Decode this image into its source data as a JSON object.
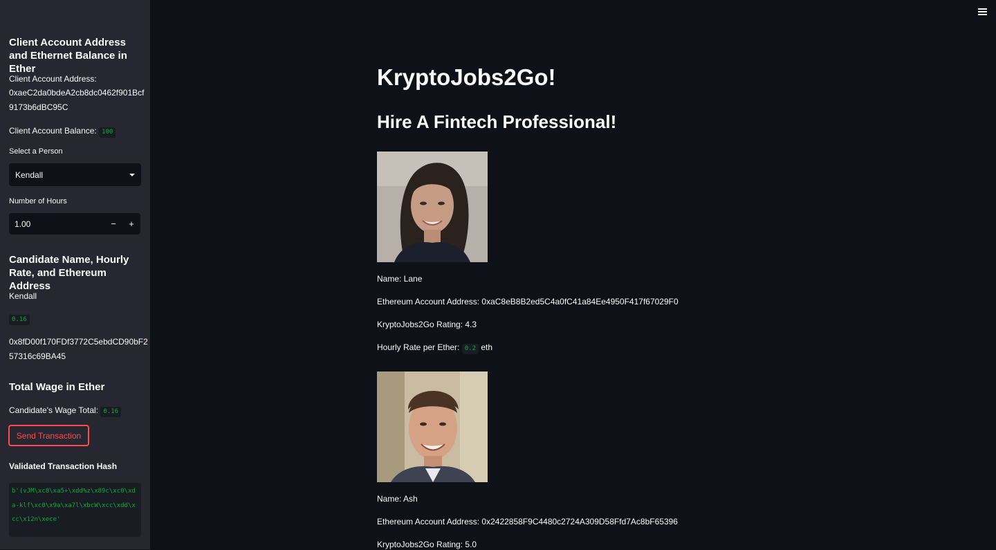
{
  "sidebar": {
    "account_heading": "Client Account Address and Ethernet Balance in Ether",
    "address_label": "Client Account Address:",
    "address_line1": "0xaeC2da0bdeA2cb8dc0462f901Bcf",
    "address_line2": "9173b6dBC95C",
    "balance_label": "Client Account Balance:",
    "balance_value": "100",
    "select_label": "Select a Person",
    "select_value": "Kendall",
    "hours_label": "Number of Hours",
    "hours_value": "1.00",
    "hours_decrement": "−",
    "hours_increment": "+",
    "candidate_heading": "Candidate Name, Hourly Rate, and Ethereum Address",
    "candidate_name": "Kendall",
    "candidate_rate": "0.16",
    "candidate_address_line1": "0x8fD00f170FDf3772C5ebdCD90bF2",
    "candidate_address_line2": "57316c69BA45",
    "wage_heading": "Total Wage in Ether",
    "wage_label": "Candidate's Wage Total:",
    "wage_value": "0.16",
    "send_button": "Send Transaction",
    "hash_heading": "Validated Transaction Hash",
    "hash_value": "b'(vJM\\xc8\\xa5+\\xdd%z\\x89c\\xc0\\xda-klf\\xc0\\x9a\\xa7l\\xbcW\\xcc\\xdd\\xcc\\x12n\\xece'"
  },
  "main": {
    "title": "KryptoJobs2Go!",
    "subtitle": "Hire A Fintech Professional!",
    "candidates": [
      {
        "name": "Name: Lane",
        "address": "Ethereum Account Address: 0xaC8eB8B2ed5C4a0fC41a84Ee4950F417f67029F0",
        "rating": "KryptoJobs2Go Rating: 4.3",
        "rate_label": "Hourly Rate per Ether:",
        "rate_value": "0.2",
        "rate_unit": "eth"
      },
      {
        "name": "Name: Ash",
        "address": "Ethereum Account Address: 0x2422858F9C4480c2724A309D58Ffd7Ac8bF65396",
        "rating": "KryptoJobs2Go Rating: 5.0"
      }
    ]
  },
  "icons": {
    "menu": "hamburger-menu-icon",
    "dropdown": "chevron-down-icon"
  },
  "colors": {
    "background": "#0e1117",
    "sidebar": "#262730",
    "accent": "#ff4b4b",
    "code_text": "#09ab3b"
  }
}
